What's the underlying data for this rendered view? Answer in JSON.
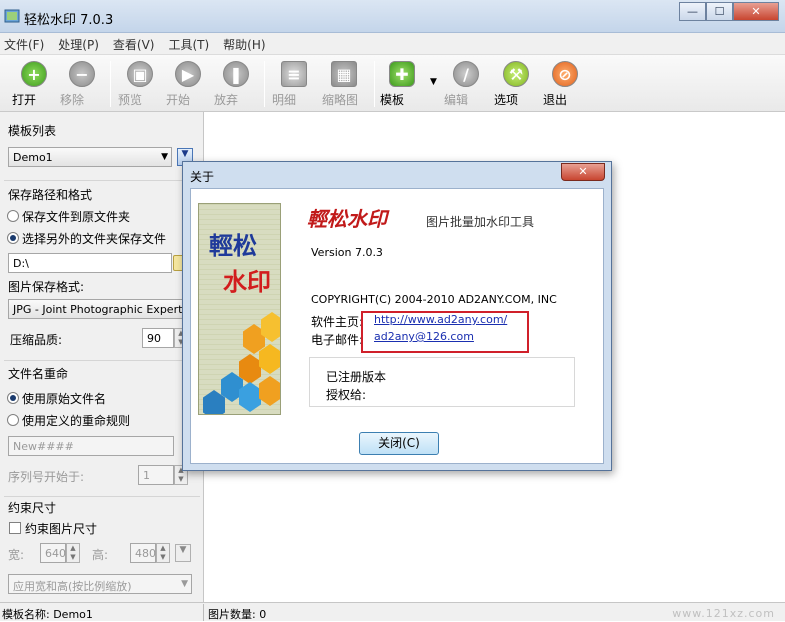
{
  "window": {
    "title": "轻松水印 7.0.3",
    "minimize": "—",
    "maximize": "☐",
    "close": "✕"
  },
  "menu": [
    "文件(F)",
    "处理(P)",
    "查看(V)",
    "工具(T)",
    "帮助(H)"
  ],
  "toolbar": {
    "open": "打开",
    "remove": "移除",
    "preview": "预览",
    "start": "开始",
    "abort": "放弃",
    "detail": "明细",
    "thumb": "缩略图",
    "template": "模板",
    "edit": "编辑",
    "options": "选项",
    "exit": "退出"
  },
  "left": {
    "template_list_title": "模板列表",
    "template_selected": "Demo1",
    "save_title": "保存路径和格式",
    "save_original": "保存文件到原文件夹",
    "save_other": "选择另外的文件夹保存文件",
    "save_path": "D:\\",
    "format_label": "图片保存格式:",
    "format_selected": "JPG - Joint Photographic Experts Gr",
    "quality_label": "压缩品质:",
    "quality_value": "90",
    "rename_title": "文件名重命",
    "rename_original": "使用原始文件名",
    "rename_custom": "使用定义的重命规则",
    "rename_pattern": "New####",
    "seq_label": "序列号开始于:",
    "seq_value": "1",
    "constrain_title": "约束尺寸",
    "constrain_chk": "约束图片尺寸",
    "width_label": "宽:",
    "width_value": "640",
    "height_label": "高:",
    "height_value": "480",
    "scale_mode": "应用宽和高(按比例缩放)"
  },
  "status": {
    "template": "模板名称: Demo1",
    "count": "图片数量:  0",
    "watermark": "www.121xz.com"
  },
  "about": {
    "title": "关于",
    "logo_line1": "輕松",
    "logo_line2": "水印",
    "brand": "輕松水印",
    "subtitle": "图片批量加水印工具",
    "version": "Version   7.0.3",
    "copyright": "COPYRIGHT(C) 2004-2010 AD2ANY.COM, INC",
    "homepage_label": "软件主页:",
    "homepage_url": "http://www.ad2any.com/",
    "email_label": "电子邮件:",
    "email": "ad2any@126.com",
    "registered": "已注册版本",
    "licensed_to": "授权给:",
    "close_button": "关闭(C)"
  }
}
